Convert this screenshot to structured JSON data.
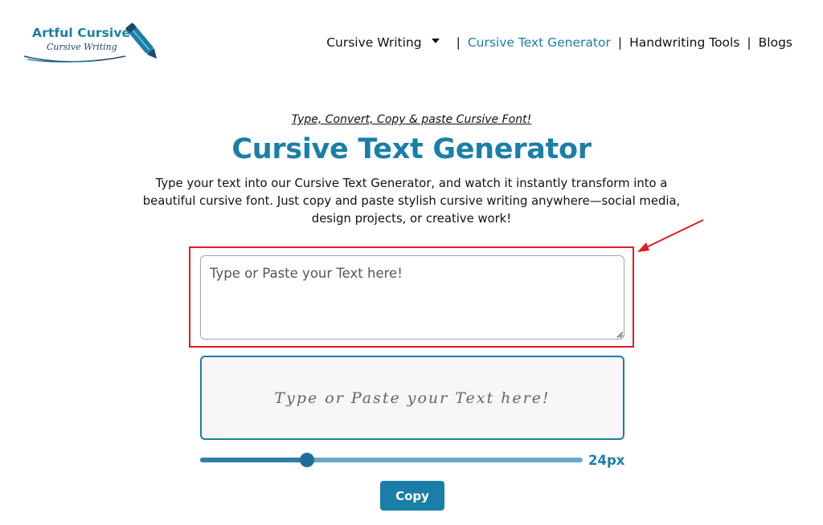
{
  "brand": {
    "title": "Artful Cursive",
    "subtitle": "Cursive Writing",
    "logo_icon": "pen-icon",
    "accent_color": "#1a7fa8"
  },
  "nav": {
    "items": [
      {
        "label": "Cursive Writing",
        "has_dropdown": true
      },
      {
        "label": "Cursive Text Generator",
        "active": true
      },
      {
        "label": "Handwriting Tools"
      },
      {
        "label": "Blogs"
      }
    ],
    "separator": "|"
  },
  "hero": {
    "tagline": "Type, Convert, Copy & paste Cursive Font!",
    "title": "Cursive Text Generator",
    "intro_line1": "Type your text into our Cursive Text Generator, and watch it instantly transform into a",
    "intro_line2": "beautiful cursive font. Just copy and paste stylish cursive writing anywhere—social media,",
    "intro_line3": "design projects, or creative work!"
  },
  "input": {
    "placeholder": "Type or Paste your Text here!",
    "value": "",
    "highlight_color": "#e11b22"
  },
  "output": {
    "preview_text": "Type or Paste your Text here!"
  },
  "font_size": {
    "min": 10,
    "max": 60,
    "value": 24,
    "label": "24px"
  },
  "actions": {
    "copy_label": "Copy"
  }
}
